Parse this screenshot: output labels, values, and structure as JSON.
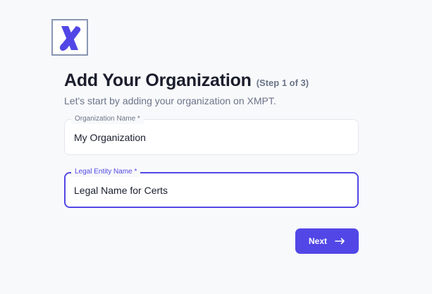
{
  "logo": {
    "icon": "xmpt-x-logo-icon",
    "color": "#5247e6"
  },
  "header": {
    "title": "Add Your Organization",
    "step": "(Step 1 of 3)",
    "subtitle": "Let's start by adding your organization on XMPT."
  },
  "form": {
    "organization_name": {
      "label": "Organization Name *",
      "value": "My Organization"
    },
    "legal_entity_name": {
      "label": "Legal Entity Name *",
      "value": "Legal Name for Certs"
    }
  },
  "actions": {
    "next_label": "Next",
    "next_icon": "arrow-right-icon"
  },
  "colors": {
    "accent": "#5247e6",
    "background": "#f8f9fb",
    "text": "#1a1e2c",
    "muted": "#6b7489"
  }
}
